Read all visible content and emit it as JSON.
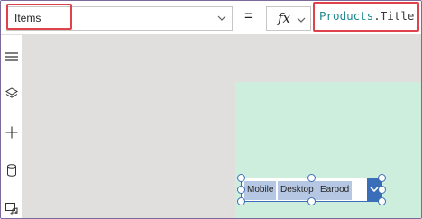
{
  "formula_bar": {
    "property_value": "Items",
    "equals_sign": "=",
    "fx_label": "fx",
    "formula": {
      "identifier": "Products",
      "separator": ".",
      "member": "Title"
    }
  },
  "left_rail": {
    "icons": [
      "hamburger-menu-icon",
      "layers-icon",
      "plus-icon",
      "database-icon",
      "media-icon"
    ]
  },
  "combobox": {
    "selected_items": [
      "Mobile",
      "Desktop",
      "Earpod"
    ]
  },
  "colors": {
    "highlight": "#e0424b",
    "canvas": "#e1dfdd",
    "screen": "#cdeedd",
    "control_accent": "#3b6eb8",
    "chip": "#b5c7e3",
    "formula_identifier": "#1e8a8f"
  }
}
